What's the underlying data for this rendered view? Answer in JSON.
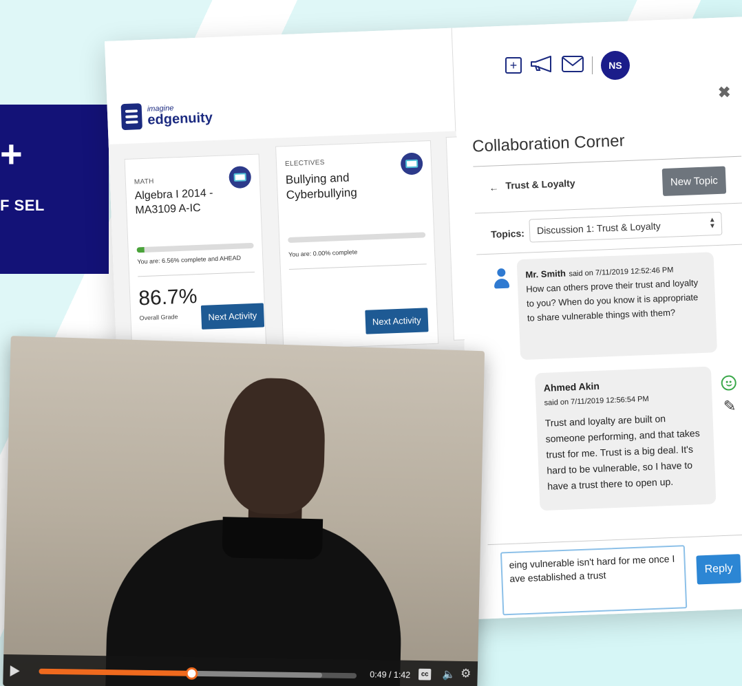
{
  "promo": {
    "plus": "+",
    "text": "F SEL"
  },
  "header": {
    "user_initials": "NS",
    "icons": [
      "add-icon",
      "megaphone-icon",
      "mail-icon"
    ]
  },
  "brand": {
    "small": "imagine",
    "big": "edgenuity"
  },
  "courses": [
    {
      "subject": "MATH",
      "title": "Algebra I 2014 - MA3109 A-IC",
      "progress": 0.0656,
      "progress_text": "You are: 6.56% complete and AHEAD",
      "grade": "86.7%",
      "grade_label": "Overall Grade",
      "button": "Next Activity"
    },
    {
      "subject": "ELECTIVES",
      "title": "Bullying and Cyberbullying",
      "progress": 0.0,
      "progress_text": "You are: 0.00% complete",
      "button": "Next Activity"
    }
  ],
  "collab": {
    "close": "✖",
    "title": "Collaboration Corner",
    "back_arrow": "←",
    "topic_name": "Trust & Loyalty",
    "new_topic": "New Topic",
    "topics_label": "Topics:",
    "topics_selected": "Discussion 1: Trust & Loyalty",
    "messages": [
      {
        "author": "Mr. Smith",
        "when": "said on 7/11/2019 12:52:46 PM",
        "text": "How can others prove their trust and loyalty to you? When do you know it is appropriate to share vulnerable things with them?"
      },
      {
        "author": "Ahmed Akin",
        "when": "said on 7/11/2019 12:56:54 PM",
        "text": "Trust and loyalty are built on someone performing, and that takes trust for me. Trust is a big deal. It's hard to be vulnerable, so I have to have a trust there to open up."
      }
    ],
    "reply_text": "eing vulnerable isn't hard for me once I ave established a trust",
    "reply_button": "Reply"
  },
  "video": {
    "time": "0:49 / 1:42",
    "progress": 0.477,
    "cc": "cc"
  },
  "colors": {
    "brand": "#1b2a80",
    "promo": "#131277",
    "next_button": "#1e5a94",
    "reply_button": "#2c86d4",
    "seek": "#f06a1e",
    "smile": "#3aa84a"
  }
}
